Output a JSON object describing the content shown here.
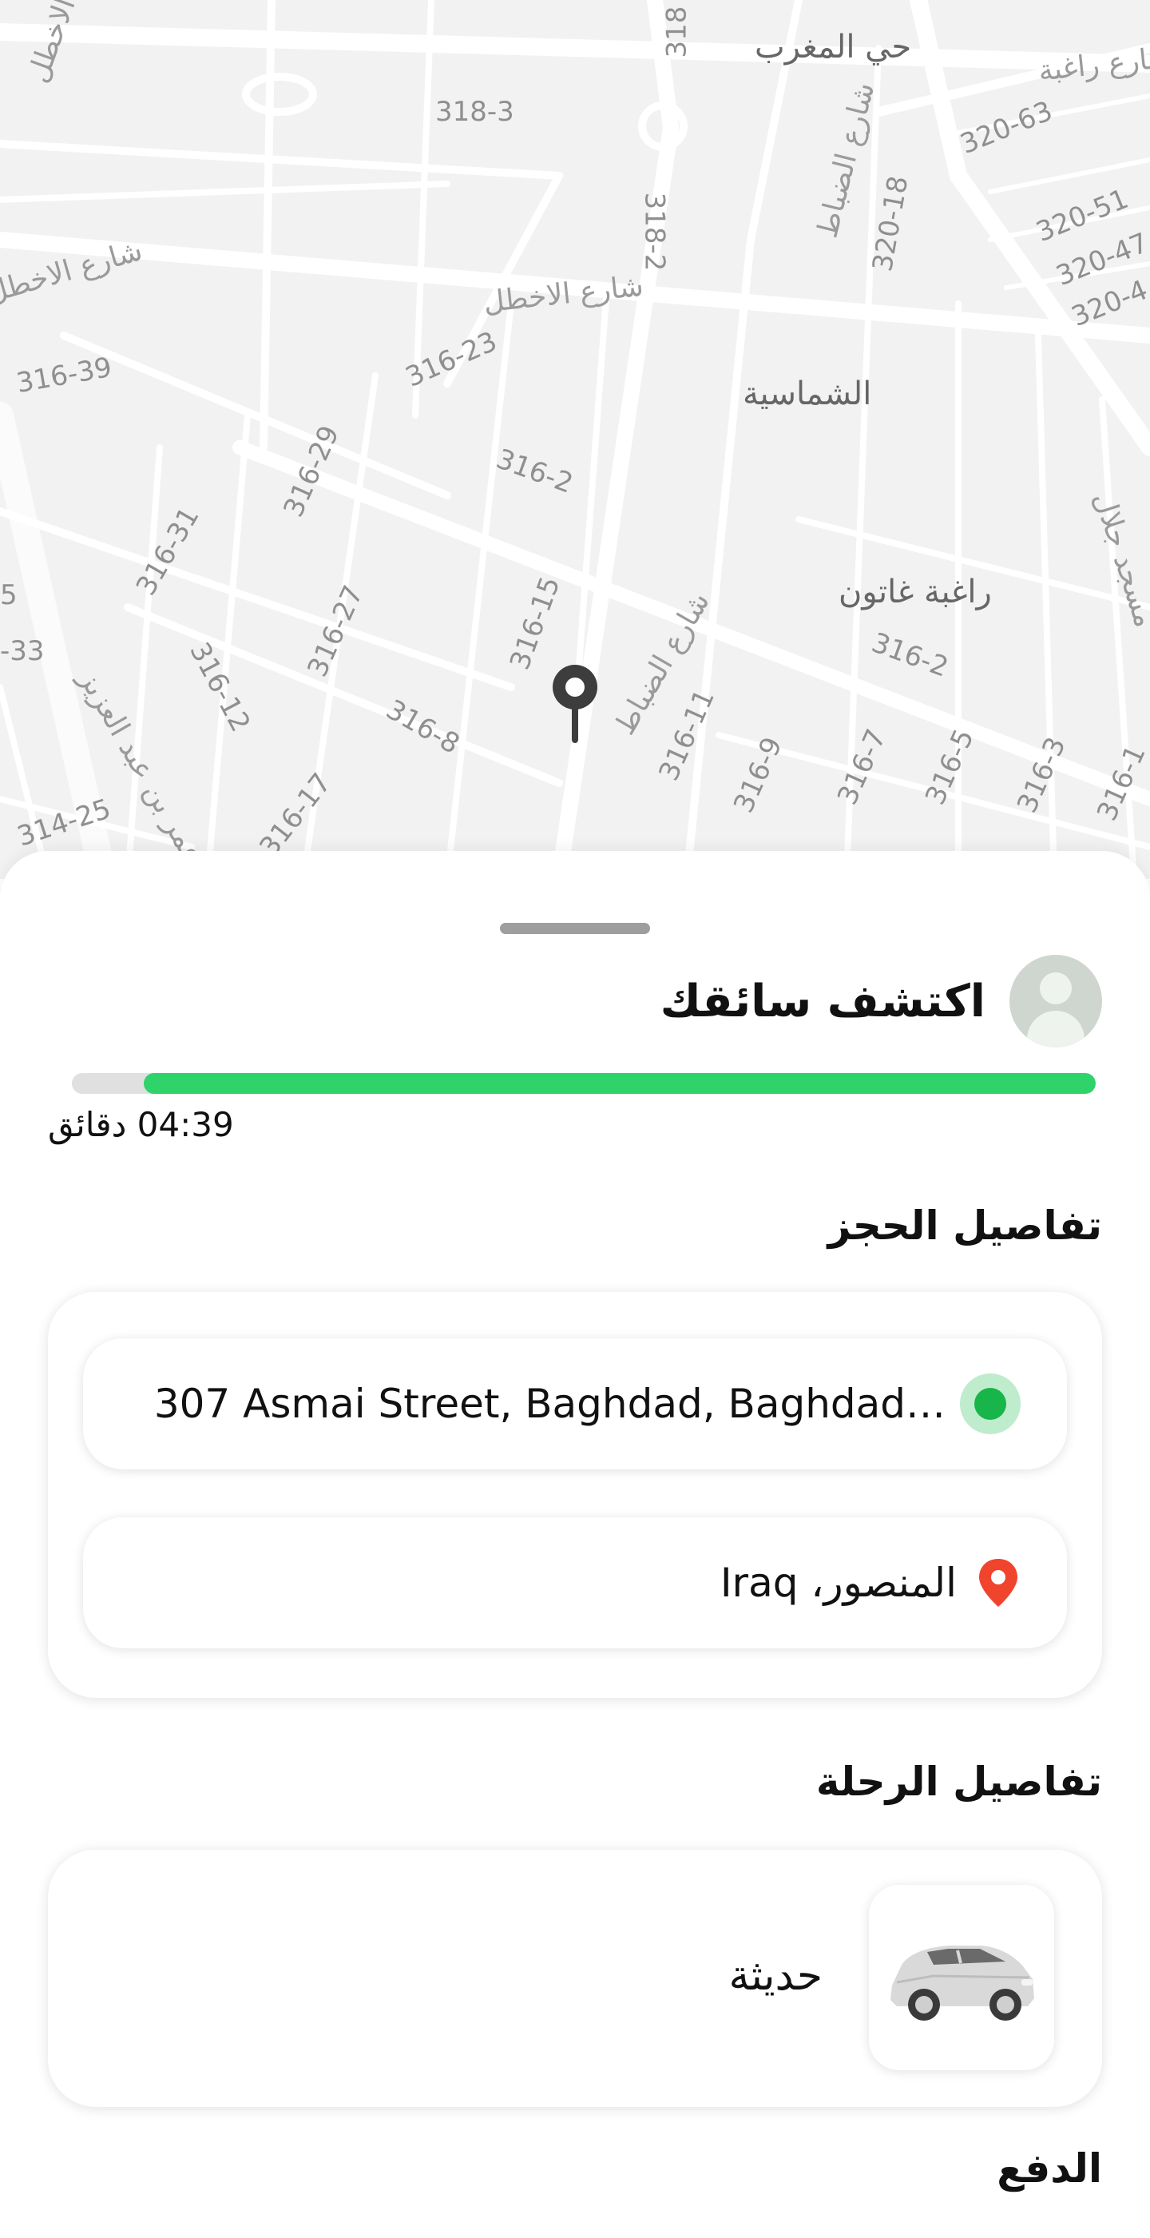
{
  "map": {
    "labels": {
      "l1": "حي المغرب",
      "l2": "الشماسية",
      "l3": "راغبة غاتون",
      "l4": "شارع الاخطل",
      "l5": "شارع الاخطل",
      "l6": "شارع الضباط",
      "l7": "شارع الضباط",
      "l8": "عمر بن عبد العزيز",
      "l9": "شارع راغبة",
      "l10": "مسجد جلال",
      "l11": "الاخطل",
      "n1": "318-3",
      "n2": "318-2",
      "n3": "318",
      "n4": "320-18",
      "n5": "320-63",
      "n6": "320-51",
      "n7": "320-47",
      "n8": "320-4",
      "n9": "316-39",
      "n10": "316-23",
      "n11": "316-2",
      "n12": "316-29",
      "n13": "316-31",
      "n14": "316-27",
      "n15": "316-15",
      "n16": "316-12",
      "n17": "316-8",
      "n18": "316-17",
      "n19": "316-11",
      "n20": "316-9",
      "n21": "316-7",
      "n22": "316-5",
      "n23": "316-3",
      "n24": "316-1",
      "n25": "316-2",
      "n26": "314-25",
      "n27": "-33",
      "n28": "5"
    }
  },
  "driver": {
    "title": "اكتشف سائقك",
    "progress": 0.93,
    "timer": "04:39 دقائق"
  },
  "booking": {
    "title": "تفاصيل الحجز",
    "pickup": "307  Asmai Street, Baghdad, Baghdad…",
    "dropoff": "المنصور، Iraq"
  },
  "trip": {
    "title": "تفاصيل الرحلة",
    "car_type": "حديثة"
  },
  "payment": {
    "title": "الدفع"
  },
  "colors": {
    "accent": "#2fd36a",
    "pickup_dot": "#17b54a",
    "dropoff_pin": "#f0442c"
  }
}
